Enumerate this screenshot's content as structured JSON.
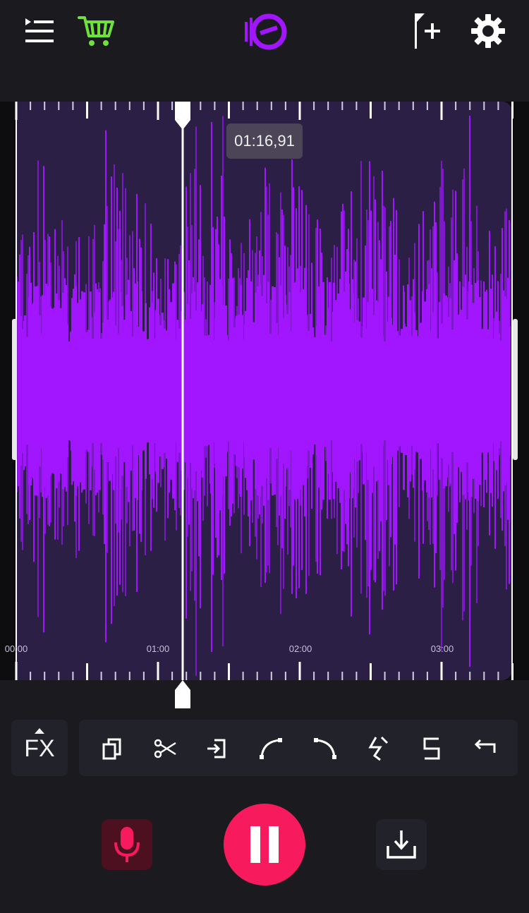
{
  "header": {
    "menu_icon": "queue-menu-icon",
    "cart_icon": "shopping-cart-icon",
    "cart_color": "#6fe23a",
    "logo_icon": "app-logo-icon",
    "logo_color": "#a116ff",
    "marker_icon": "add-marker-flag-icon",
    "settings_icon": "gear-icon"
  },
  "waveform": {
    "color": "#a116ff",
    "background": "#2b1f46",
    "current_time": "01:16,91",
    "time_labels": [
      "00:00",
      "01:00",
      "02:00",
      "03:00"
    ]
  },
  "toolbar": {
    "fx_label": "FX",
    "tools": [
      {
        "icon": "copy-icon"
      },
      {
        "icon": "scissors-icon"
      },
      {
        "icon": "insert-icon"
      },
      {
        "icon": "fade-in-icon"
      },
      {
        "icon": "fade-out-icon"
      },
      {
        "icon": "normalize-icon"
      },
      {
        "icon": "split-icon"
      },
      {
        "icon": "undo-icon"
      }
    ]
  },
  "controls": {
    "record_icon": "microphone-icon",
    "record_color": "#f71a5d",
    "pause_icon": "pause-icon",
    "pause_color": "#f71a5d",
    "save_icon": "download-icon"
  }
}
